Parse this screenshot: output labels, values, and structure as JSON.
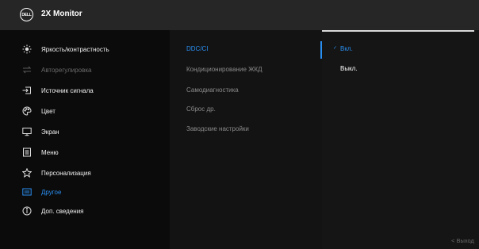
{
  "header": {
    "logo_text": "DELL",
    "title": "2X Monitor"
  },
  "menu": [
    {
      "label": "Яркость/контрастность",
      "icon": "brightness-icon",
      "state": "normal"
    },
    {
      "label": "Авторегулировка",
      "icon": "auto-adjust-icon",
      "state": "disabled"
    },
    {
      "label": "Источник сигнала",
      "icon": "input-source-icon",
      "state": "normal"
    },
    {
      "label": "Цвет",
      "icon": "color-palette-icon",
      "state": "normal"
    },
    {
      "label": "Экран",
      "icon": "display-monitor-icon",
      "state": "normal"
    },
    {
      "label": "Меню",
      "icon": "menu-list-icon",
      "state": "normal"
    },
    {
      "label": "Персонализация",
      "icon": "star-icon",
      "state": "normal"
    },
    {
      "label": "Другое",
      "icon": "others-icon",
      "state": "active"
    },
    {
      "label": "Доп. сведения",
      "icon": "info-icon",
      "state": "normal"
    }
  ],
  "submenu": [
    {
      "label": "DDC/CI",
      "state": "active"
    },
    {
      "label": "Кондиционирование ЖКД",
      "state": "normal"
    },
    {
      "label": "Самодиагностика",
      "state": "normal"
    },
    {
      "label": "Сброс др.",
      "state": "normal"
    },
    {
      "label": "Заводские настройки",
      "state": "normal"
    }
  ],
  "options": [
    {
      "label": "Вкл.",
      "checked": true,
      "check_mark": "✓"
    },
    {
      "label": "Выкл.",
      "checked": false
    }
  ],
  "footer": {
    "back_label": "Выход",
    "back_glyph": "<"
  },
  "colors": {
    "accent": "#2a8ef0",
    "header_bg": "#262626",
    "background": "#000000"
  }
}
